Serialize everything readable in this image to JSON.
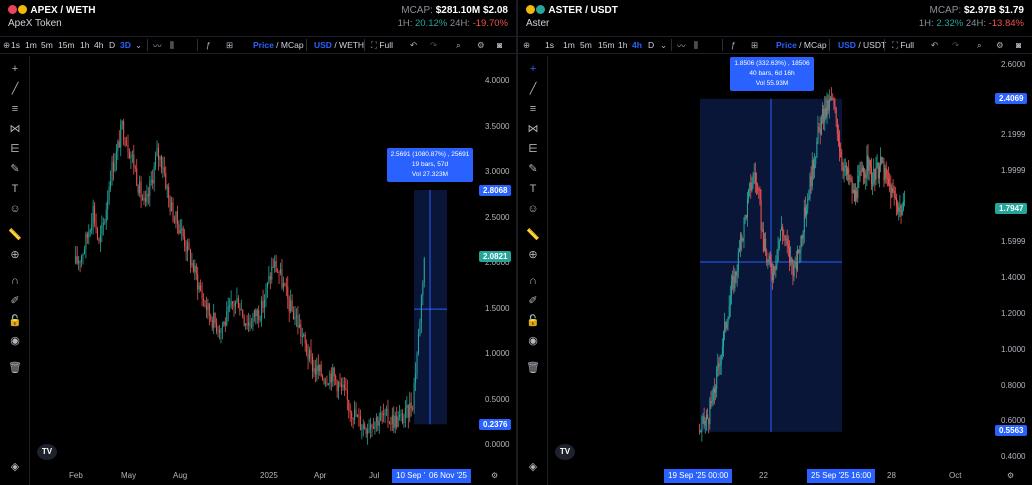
{
  "left": {
    "pair": "APEX / WETH",
    "token_name": "ApeX Token",
    "mcap_label": "MCAP:",
    "mcap_value": "$281.10M",
    "price": "$2.08",
    "h1_label": "1H:",
    "h1_change": "20.12%",
    "h24_label": "24H:",
    "h24_change": "-19.70%",
    "timeframes": [
      "1s",
      "1m",
      "5m",
      "15m",
      "1h",
      "4h",
      "D",
      "3D"
    ],
    "active_timeframe": "3D",
    "price_toggle": "Price",
    "mcap_toggle": "MCap",
    "usd_toggle": "USD",
    "quote_toggle": "WETH",
    "full_label": "Full",
    "price_badge": "2.0821",
    "upper_badge": "2.8068",
    "lower_badge": "0.2376",
    "range_info": [
      "2.5691 (1080.87%) , 25691",
      "19 bars, 57d",
      "Vol 27.323M"
    ],
    "x_start_badge": "10 Sep '",
    "x_end_badge": "06 Nov '25"
  },
  "right": {
    "pair": "ASTER / USDT",
    "token_name": "Aster",
    "mcap_label": "MCAP:",
    "mcap_value": "$2.97B",
    "price": "$1.79",
    "h1_label": "1H:",
    "h1_change": "2.32%",
    "h24_label": "24H:",
    "h24_change": "-13.84%",
    "timeframes": [
      "1s",
      "1m",
      "5m",
      "15m",
      "1h",
      "4h",
      "D"
    ],
    "active_timeframe": "4h",
    "price_toggle": "Price",
    "mcap_toggle": "MCap",
    "usd_toggle": "USD",
    "quote_toggle": "USDT",
    "full_label": "Full",
    "price_badge": "1.7947",
    "upper_badge": "2.4069",
    "lower_badge": "0.5563",
    "range_info": [
      "1.8506 (332.63%) , 18506",
      "40 bars, 6d 16h",
      "Vol 55.93M"
    ],
    "x_start_badge": "19 Sep '25  00:00",
    "x_end_badge": "25 Sep '25  16:00"
  },
  "chart_data": [
    {
      "type": "candlestick",
      "title": "APEX / WETH",
      "y_ticks": [
        "4.0000",
        "3.5000",
        "3.0000",
        "2.5000",
        "2.0000",
        "1.5000",
        "1.0000",
        "0.5000",
        "0.0000"
      ],
      "ylim": [
        0,
        4.1
      ],
      "x_ticks": [
        "Feb",
        "May",
        "Aug",
        "2025",
        "Apr",
        "Jul"
      ],
      "up_color": "#26a69a",
      "down_color": "#ef5350",
      "close_series": [
        2.0,
        2.1,
        2.3,
        2.6,
        2.2,
        2.5,
        3.0,
        3.2,
        3.5,
        3.3,
        3.1,
        2.8,
        2.6,
        2.9,
        3.2,
        3.1,
        2.7,
        2.5,
        2.4,
        2.2,
        2.0,
        1.8,
        1.6,
        1.45,
        1.35,
        1.3,
        1.4,
        1.55,
        1.6,
        1.4,
        1.35,
        1.45,
        1.5,
        1.75,
        2.0,
        1.9,
        1.7,
        1.5,
        1.4,
        1.2,
        1.0,
        0.85,
        0.8,
        0.75,
        0.8,
        0.7,
        0.6,
        0.45,
        0.35,
        0.25,
        0.22,
        0.28,
        0.3,
        0.32,
        0.3,
        0.28,
        0.3,
        0.35,
        0.5,
        1.2,
        2.08
      ],
      "range_measure": {
        "change": 2.5691,
        "percent": "1080.87%",
        "bars": 19,
        "span": "57d",
        "volume": "27.323M"
      },
      "last_price": 2.0821
    },
    {
      "type": "candlestick",
      "title": "ASTER / USDT",
      "y_ticks": [
        "2.6000",
        "2.1999",
        "1.9999",
        "1.5999",
        "1.4000",
        "1.2000",
        "1.0000",
        "0.8000",
        "0.6000",
        "0.4000"
      ],
      "ylim": [
        0.4,
        2.6
      ],
      "x_ticks": [
        "22",
        "28",
        "Oct"
      ],
      "up_color": "#26a69a",
      "down_color": "#ef5350",
      "close_series": [
        0.56,
        0.6,
        0.65,
        0.75,
        0.9,
        1.05,
        1.2,
        1.35,
        1.45,
        1.6,
        1.75,
        1.9,
        2.0,
        1.85,
        1.6,
        1.5,
        1.45,
        1.55,
        1.7,
        1.6,
        1.5,
        1.45,
        1.6,
        1.75,
        1.9,
        2.05,
        2.2,
        2.3,
        2.35,
        2.4,
        2.3,
        2.1,
        2.0,
        1.95,
        1.85,
        1.95,
        2.0,
        2.05,
        1.95,
        2.0,
        2.05,
        1.95,
        1.9,
        1.85,
        1.8,
        1.79
      ],
      "range_measure": {
        "change": 1.8506,
        "percent": "332.63%",
        "bars": 40,
        "span": "6d 16h",
        "volume": "55.93M"
      },
      "last_price": 1.7947
    }
  ]
}
